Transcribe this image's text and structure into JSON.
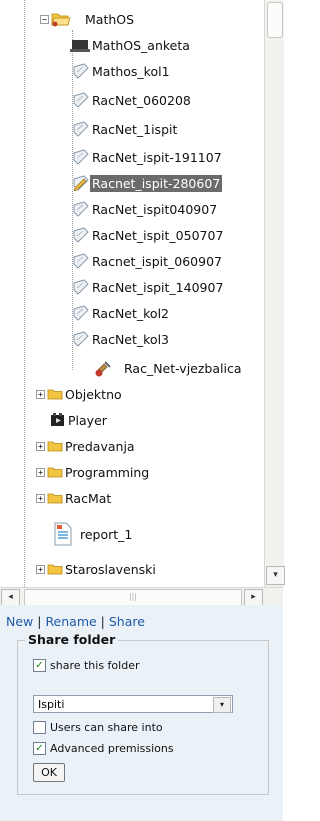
{
  "tree": {
    "items": [
      {
        "label": "MathOS",
        "icon": "folder-open-icon"
      },
      {
        "label": "MathOS_anketa",
        "icon": "survey-icon"
      },
      {
        "label": "Mathos_kol1",
        "icon": "quiz-icon"
      },
      {
        "label": "RacNet_060208",
        "icon": "quiz-icon"
      },
      {
        "label": "RacNet_1ispit",
        "icon": "quiz-icon"
      },
      {
        "label": "RacNet_ispit-191107",
        "icon": "quiz-icon"
      },
      {
        "label": "Racnet_ispit-280607",
        "icon": "quiz-edit-icon",
        "selected": true
      },
      {
        "label": "RacNet_ispit040907",
        "icon": "quiz-icon"
      },
      {
        "label": "RacNet_ispit_050707",
        "icon": "quiz-icon"
      },
      {
        "label": "Racnet_ispit_060907",
        "icon": "quiz-icon"
      },
      {
        "label": "RacNet_ispit_140907",
        "icon": "quiz-icon"
      },
      {
        "label": "RacNet_kol2",
        "icon": "quiz-icon"
      },
      {
        "label": "RacNet_kol3",
        "icon": "quiz-icon"
      },
      {
        "label": "Rac_Net-vjezbalica",
        "icon": "tools-icon"
      },
      {
        "label": "Objektno",
        "icon": "folder-icon"
      },
      {
        "label": "Player",
        "icon": "player-icon"
      },
      {
        "label": "Predavanja",
        "icon": "folder-icon"
      },
      {
        "label": "Programming",
        "icon": "folder-icon"
      },
      {
        "label": "RacMat",
        "icon": "folder-icon"
      },
      {
        "label": "report_1",
        "icon": "report-icon"
      },
      {
        "label": "Staroslavenski",
        "icon": "folder-icon"
      }
    ],
    "expand_symbol": "+",
    "collapse_symbol": "−"
  },
  "scrollbars": {
    "up_arrow": "▴",
    "down_arrow": "▾",
    "left_arrow": "◂",
    "right_arrow": "▸",
    "grip": "|||"
  },
  "actions": {
    "new_label": "New",
    "rename_label": "Rename",
    "share_label": "Share",
    "separator": " | "
  },
  "share_folder": {
    "legend": "Share folder",
    "share_this_folder_label": "share this folder",
    "share_this_folder_checked": true,
    "selected_folder": "Ispiti",
    "users_can_share_label": "Users can share into",
    "users_can_share_checked": false,
    "advanced_permissions_label": "Advanced premissions",
    "advanced_permissions_checked": true,
    "ok_label": "OK",
    "check_mark": "✓"
  },
  "colors": {
    "selection_bg": "#6b6b6b",
    "folder": "#f3c441",
    "link": "#1f5aa6",
    "panel_bg": "#eaf2f8"
  }
}
